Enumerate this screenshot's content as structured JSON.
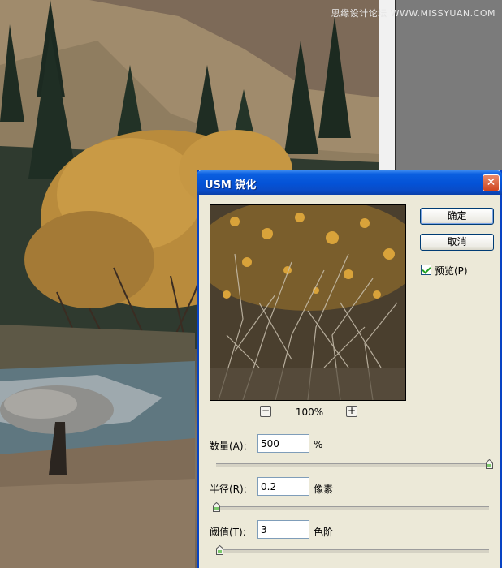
{
  "watermark": "思缘设计论坛 WWW.MISSYUAN.COM",
  "dialog": {
    "title": "USM 锐化",
    "close_label": "✕",
    "ok_label": "确定",
    "cancel_label": "取消",
    "preview_label": "预览(P)",
    "preview_checked": true,
    "zoom": {
      "minus": "−",
      "plus": "+",
      "value": "100%"
    },
    "params": {
      "amount": {
        "label": "数量(A):",
        "value": "500",
        "unit": "%",
        "fraction": 1.0
      },
      "radius": {
        "label": "半径(R):",
        "value": "0.2",
        "unit": "像素",
        "fraction": 0.0
      },
      "threshold": {
        "label": "阈值(T):",
        "value": "3",
        "unit": "色阶",
        "fraction": 0.012
      }
    }
  },
  "colors": {
    "titlebar": "#0452d6",
    "dialog_bg": "#ece9d8",
    "close": "#d0451f"
  }
}
